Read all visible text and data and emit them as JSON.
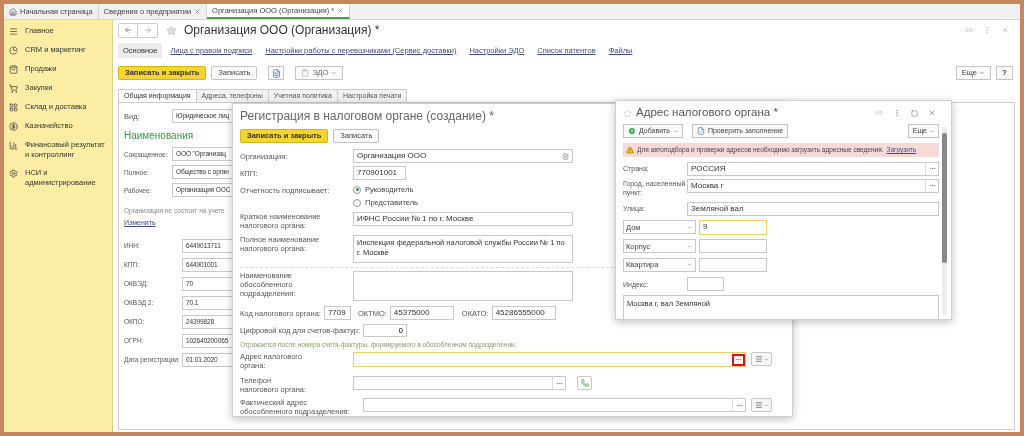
{
  "top_tabs": [
    {
      "label": "Начальная страница",
      "kind": "home",
      "selected": false,
      "closable": false
    },
    {
      "label": "Сведения о предприятии",
      "kind": "page",
      "selected": false,
      "closable": true
    },
    {
      "label": "Организация ООО (Организация) *",
      "kind": "page",
      "selected": true,
      "closable": true
    }
  ],
  "sidebar": {
    "items": [
      {
        "label": "Главное"
      },
      {
        "label": "CRM и маркетинг"
      },
      {
        "label": "Продажи"
      },
      {
        "label": "Закупки"
      },
      {
        "label": "Склад и доставка"
      },
      {
        "label": "Казначейство"
      },
      {
        "label": "Финансовый результат и контроллинг"
      },
      {
        "label": "НСИ и администрирование"
      }
    ]
  },
  "form": {
    "title": "Организация ООО (Организация) *",
    "nav": [
      {
        "label": "Основное",
        "selected": true
      },
      {
        "label": "Лица с правом подписи",
        "selected": false
      },
      {
        "label": "Настройки работы с перевозчиками (Сервис доставки)",
        "selected": false
      },
      {
        "label": "Настройки ЭДО",
        "selected": false
      },
      {
        "label": "Список патентов",
        "selected": false
      },
      {
        "label": "Файлы",
        "selected": false
      }
    ],
    "toolbar": {
      "save_close": "Записать и закрыть",
      "save": "Записать",
      "edo": "ЭДО",
      "more": "Еще",
      "help": "?"
    },
    "tabs": [
      {
        "label": "Общая информация",
        "selected": true
      },
      {
        "label": "Адреса, телефоны",
        "selected": false
      },
      {
        "label": "Учетная политика",
        "selected": false
      },
      {
        "label": "Настройка печати",
        "selected": false
      }
    ],
    "general": {
      "type_label": "Вид:",
      "type_value": "Юридическое лиц",
      "section": "Наименования",
      "names": [
        {
          "label": "Сокращенное:",
          "value": "ООО \"Организац"
        },
        {
          "label": "Полное:",
          "value": "Общество с орган"
        },
        {
          "label": "Рабочее:",
          "value": "Организация ООС"
        }
      ],
      "note": "Организация не состоит на учете",
      "change_link": "Изменить",
      "codes": [
        {
          "label": "ИНН:",
          "value": "6449013711"
        },
        {
          "label": "КПП:",
          "value": "644901001"
        },
        {
          "label": "ОКВЭД:",
          "value": "70"
        },
        {
          "label": "ОКВЭД 2:",
          "value": "70.1"
        },
        {
          "label": "ОКПО:",
          "value": "24399828"
        },
        {
          "label": "ОГРН:",
          "value": "102640200065"
        },
        {
          "label": "Дата регистрации:",
          "value": "01.01.2020"
        }
      ]
    }
  },
  "registration_dialog": {
    "title": "Регистрация в налоговом органе (создание) *",
    "save_close": "Записать и закрыть",
    "save": "Записать",
    "organization": {
      "label": "Организация:",
      "value": "Организация ООО"
    },
    "kpp": {
      "label": "КПП:",
      "value": "770901001"
    },
    "signer": {
      "label": "Отчетность подписывает:",
      "options": [
        {
          "label": "Руководитель",
          "selected": true
        },
        {
          "label": "Представитель",
          "selected": false
        }
      ]
    },
    "short_name": {
      "label": "Краткое наименование налогового органа:",
      "value": "ИФНС России № 1 по г. Москве"
    },
    "full_name": {
      "label": "Полное наименование налогового органа:",
      "value": "Инспекция федеральной налоговой службы России № 1 по г. Москве"
    },
    "branch_name": {
      "label": "Наименование обособленного подразделения:"
    },
    "tax_code": {
      "label": "Код налогового органа:",
      "value": "7709"
    },
    "oktmo": {
      "label": "ОКТМО:",
      "value": "45375000"
    },
    "okato": {
      "label": "ОКАТО:",
      "value": "45286555000"
    },
    "invoice_code": {
      "label": "Цифровой код для счетов-фактур:",
      "value": "0"
    },
    "invoice_note": "Отражается после номера счета-фактуры, формируемого в обособленном подразделении.",
    "tax_address": {
      "label": "Адрес налогового органа:"
    },
    "phone": {
      "label": "Телефон налогового органа:"
    },
    "actual_address": {
      "label": "Фактический адрес обособленного подразделения:"
    }
  },
  "address_dialog": {
    "title": "Адрес налогового органа *",
    "add": "Добавить",
    "check": "Проверить заполнение",
    "more": "Еще",
    "warning": {
      "text": "Для автоподбора и проверки адресов необходимо загрузить адресные сведения.",
      "link": "Загрузить"
    },
    "country": {
      "label": "Страна:",
      "value": "РОССИЯ"
    },
    "city": {
      "label": "Город, населенный пункт:",
      "value": "Москва г"
    },
    "street": {
      "label": "Улица:",
      "value": "Земляной вал"
    },
    "parts": [
      {
        "type": "Дом",
        "value": "9",
        "focused": true
      },
      {
        "type": "Корпус",
        "focused": false
      },
      {
        "type": "Квартира",
        "focused": false
      }
    ],
    "index": {
      "label": "Индекс:"
    },
    "summary": "Москва г, вал Земляной"
  }
}
